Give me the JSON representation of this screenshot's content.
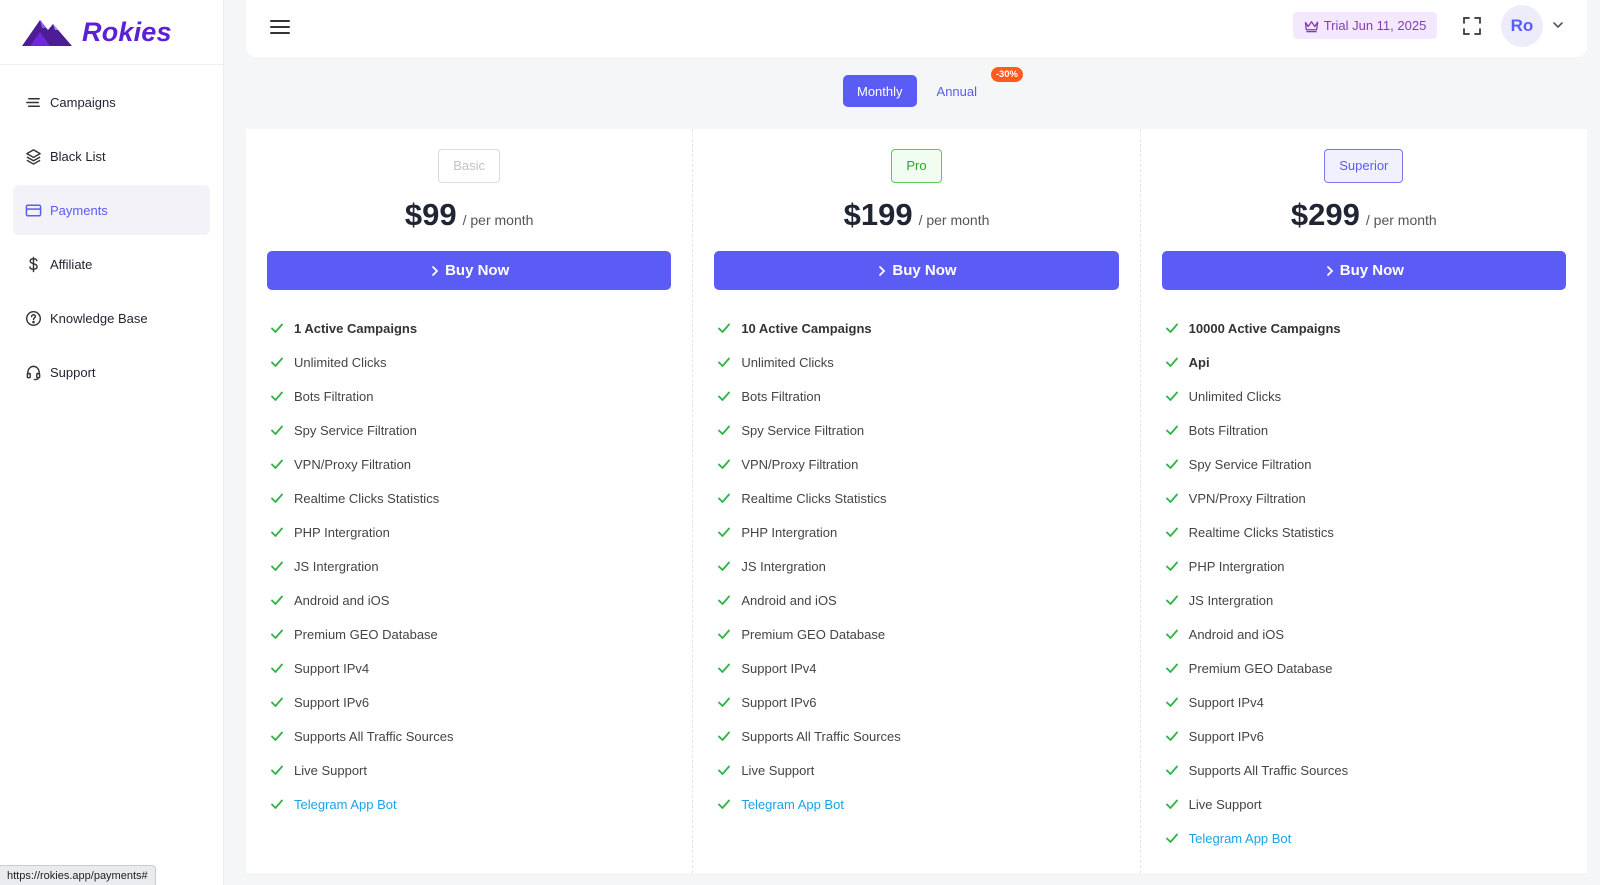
{
  "brand": {
    "name": "Rokies",
    "color": "#5b21d6"
  },
  "sidebar": {
    "items": [
      {
        "label": "Campaigns",
        "icon": "lines-icon",
        "active": false
      },
      {
        "label": "Black List",
        "icon": "layers-icon",
        "active": false
      },
      {
        "label": "Payments",
        "icon": "credit-card-icon",
        "active": true
      },
      {
        "label": "Affiliate",
        "icon": "dollar-icon",
        "active": false
      },
      {
        "label": "Knowledge Base",
        "icon": "help-circle-icon",
        "active": false
      },
      {
        "label": "Support",
        "icon": "headset-icon",
        "active": false
      }
    ]
  },
  "topbar": {
    "trial_label": "Trial Jun 11, 2025",
    "avatar_initials": "Ro"
  },
  "billing_toggle": {
    "monthly_label": "Monthly",
    "annual_label": "Annual",
    "discount_label": "-30%",
    "selected": "Monthly"
  },
  "plans": [
    {
      "name": "Basic",
      "price": "$99",
      "period": "/ per month",
      "buy_label": "Buy Now",
      "features": [
        {
          "text": "1 Active Campaigns",
          "style": "bold"
        },
        {
          "text": "Unlimited Clicks"
        },
        {
          "text": "Bots Filtration"
        },
        {
          "text": "Spy Service Filtration"
        },
        {
          "text": "VPN/Proxy Filtration"
        },
        {
          "text": "Realtime Clicks Statistics"
        },
        {
          "text": "PHP Intergration"
        },
        {
          "text": "JS Intergration"
        },
        {
          "text": "Android and iOS"
        },
        {
          "text": "Premium GEO Database"
        },
        {
          "text": "Support IPv4"
        },
        {
          "text": "Support IPv6"
        },
        {
          "text": "Supports All Traffic Sources"
        },
        {
          "text": "Live Support"
        },
        {
          "text": "Telegram App Bot",
          "style": "link"
        }
      ]
    },
    {
      "name": "Pro",
      "price": "$199",
      "period": "/ per month",
      "buy_label": "Buy Now",
      "features": [
        {
          "text": "10 Active Campaigns",
          "style": "bold"
        },
        {
          "text": "Unlimited Clicks"
        },
        {
          "text": "Bots Filtration"
        },
        {
          "text": "Spy Service Filtration"
        },
        {
          "text": "VPN/Proxy Filtration"
        },
        {
          "text": "Realtime Clicks Statistics"
        },
        {
          "text": "PHP Intergration"
        },
        {
          "text": "JS Intergration"
        },
        {
          "text": "Android and iOS"
        },
        {
          "text": "Premium GEO Database"
        },
        {
          "text": "Support IPv4"
        },
        {
          "text": "Support IPv6"
        },
        {
          "text": "Supports All Traffic Sources"
        },
        {
          "text": "Live Support"
        },
        {
          "text": "Telegram App Bot",
          "style": "link"
        }
      ]
    },
    {
      "name": "Superior",
      "price": "$299",
      "period": "/ per month",
      "buy_label": "Buy Now",
      "features": [
        {
          "text": "10000 Active Campaigns",
          "style": "bold"
        },
        {
          "text": "Api",
          "style": "bold"
        },
        {
          "text": "Unlimited Clicks"
        },
        {
          "text": "Bots Filtration"
        },
        {
          "text": "Spy Service Filtration"
        },
        {
          "text": "VPN/Proxy Filtration"
        },
        {
          "text": "Realtime Clicks Statistics"
        },
        {
          "text": "PHP Intergration"
        },
        {
          "text": "JS Intergration"
        },
        {
          "text": "Android and iOS"
        },
        {
          "text": "Premium GEO Database"
        },
        {
          "text": "Support IPv4"
        },
        {
          "text": "Support IPv6"
        },
        {
          "text": "Supports All Traffic Sources"
        },
        {
          "text": "Live Support"
        },
        {
          "text": "Telegram App Bot",
          "style": "link"
        }
      ]
    }
  ],
  "status_bar": {
    "url": "https://rokies.app/payments#"
  },
  "colors": {
    "accent": "#5b5bf5",
    "check": "#2fb344",
    "link": "#1aa4e6",
    "discount": "#ff5a1f"
  }
}
